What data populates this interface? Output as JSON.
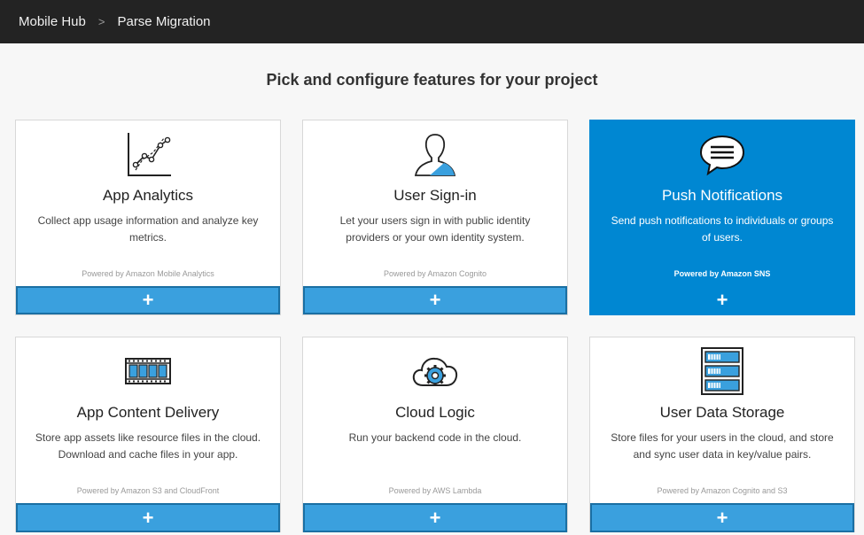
{
  "breadcrumb": {
    "root": "Mobile Hub",
    "separator": ">",
    "current": "Parse Migration"
  },
  "heading": "Pick and configure features for your project",
  "add_symbol": "+",
  "colors": {
    "topbar": "#232323",
    "accent": "#0087d2",
    "add_button": "#3aa0de"
  },
  "features": [
    {
      "icon": "line-chart-icon",
      "title": "App Analytics",
      "desc": "Collect app usage information and analyze key metrics.",
      "powered": "Powered by Amazon Mobile Analytics",
      "selected": false
    },
    {
      "icon": "user-icon",
      "title": "User Sign-in",
      "desc": "Let your users sign in with public identity providers or your own identity system.",
      "powered": "Powered by Amazon Cognito",
      "selected": false
    },
    {
      "icon": "chat-bubble-icon",
      "title": "Push Notifications",
      "desc": "Send push notifications to individuals or groups of users.",
      "powered": "Powered by Amazon SNS",
      "selected": true
    },
    {
      "icon": "film-strip-icon",
      "title": "App Content Delivery",
      "desc": "Store app assets like resource files in the cloud. Download and cache files in your app.",
      "powered": "Powered by Amazon S3 and CloudFront",
      "selected": false
    },
    {
      "icon": "cloud-gear-icon",
      "title": "Cloud Logic",
      "desc": "Run your backend code in the cloud.",
      "powered": "Powered by AWS Lambda",
      "selected": false
    },
    {
      "icon": "server-stack-icon",
      "title": "User Data Storage",
      "desc": "Store files for your users in the cloud, and store and sync user data in key/value pairs.",
      "powered": "Powered by Amazon Cognito and S3",
      "selected": false
    }
  ]
}
